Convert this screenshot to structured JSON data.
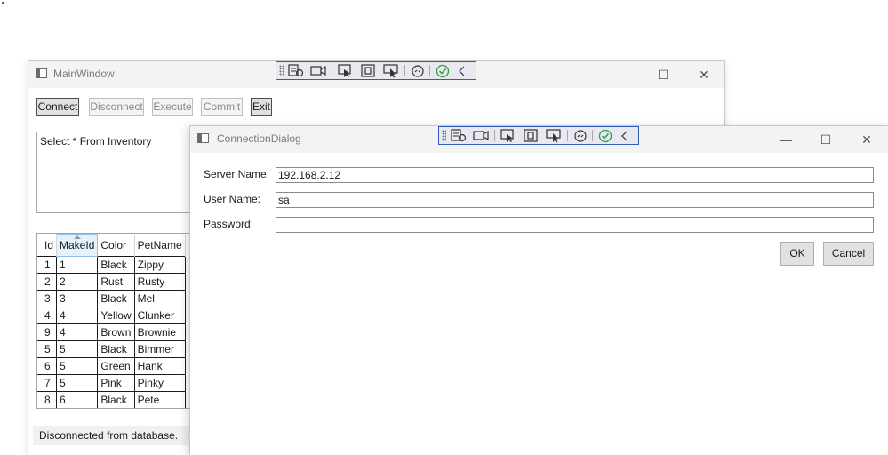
{
  "main_window": {
    "title": "MainWindow",
    "buttons": {
      "connect": "Connect",
      "disconnect": "Disconnect",
      "execute": "Execute",
      "commit": "Commit",
      "exit": "Exit"
    },
    "query_text": "Select * From Inventory",
    "grid": {
      "columns": [
        "Id",
        "MakeId",
        "Color",
        "PetName"
      ],
      "sorted_column": "MakeId",
      "rows": [
        [
          "1",
          "1",
          "Black",
          "Zippy"
        ],
        [
          "2",
          "2",
          "Rust",
          "Rusty"
        ],
        [
          "3",
          "3",
          "Black",
          "Mel"
        ],
        [
          "4",
          "4",
          "Yellow",
          "Clunker"
        ],
        [
          "9",
          "4",
          "Brown",
          "Brownie"
        ],
        [
          "5",
          "5",
          "Black",
          "Bimmer"
        ],
        [
          "6",
          "5",
          "Green",
          "Hank"
        ],
        [
          "7",
          "5",
          "Pink",
          "Pinky"
        ],
        [
          "8",
          "6",
          "Black",
          "Pete"
        ]
      ]
    },
    "status_text": "Disconnected from database."
  },
  "dialog": {
    "title": "ConnectionDialog",
    "server_label": "Server Name:",
    "server_value": "192.168.2.12",
    "user_label": "User Name:",
    "user_value": "sa",
    "password_label": "Password:",
    "password_value": "",
    "ok_label": "OK",
    "cancel_label": "Cancel"
  },
  "window_controls": {
    "minimize": "—",
    "maximize": "☐",
    "close": "✕"
  },
  "colors": {
    "debug_toolbar_border": "#2f5db8",
    "check_green": "#2ea043",
    "titlebar_bg": "#f3f3f3"
  }
}
